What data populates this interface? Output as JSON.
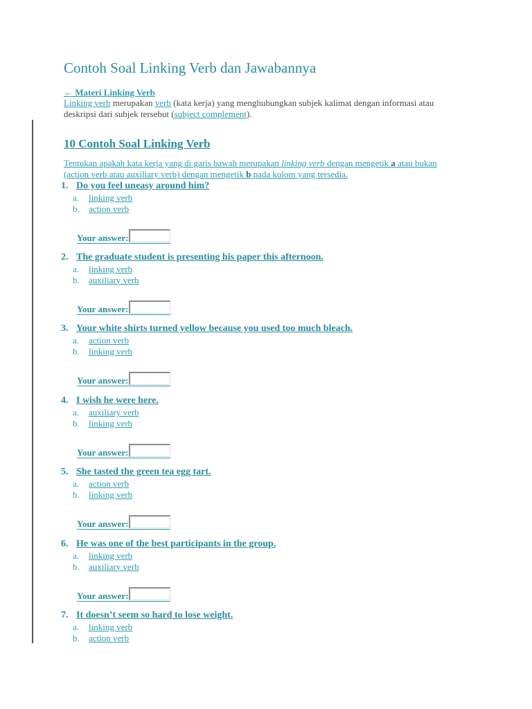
{
  "page": {
    "title": "Contoh Soal Linking Verb dan Jawabannya",
    "back_link": "← Materi Linking Verb",
    "intro": {
      "link1": "Linking verb",
      "text1": " merupakan ",
      "link2": "verb",
      "text2": " (kata kerja) yang menghubungkan subjek kalimat dengan informasi atau deskripsi dari subjek tersebut (",
      "link3": "subject complement",
      "text3": ")."
    }
  },
  "section": {
    "title": "10 Contoh Soal Linking Verb",
    "instructions": {
      "part1": "Tentukan apakah kata kerja yang di garis bawah merupakan ",
      "italic": "linking verb",
      "part2": " dengan mengetik ",
      "bold_a": "a",
      "part3": " atau bukan (action verb atau auxiliary verb) dengan mengetik ",
      "bold_b": "b",
      "part4": " pada kolom yang tersedia."
    }
  },
  "answer_label": "Your answer:",
  "questions": [
    {
      "num": "1.",
      "text": "Do you feel uneasy around him?",
      "options": [
        {
          "letter": "a.",
          "label": "linking verb"
        },
        {
          "letter": "b.",
          "label": "action verb"
        }
      ],
      "answer": ""
    },
    {
      "num": "2.",
      "text": "The graduate student is presenting his paper this afternoon.",
      "options": [
        {
          "letter": "a.",
          "label": "linking verb"
        },
        {
          "letter": "b.",
          "label": "auxiliary verb"
        }
      ],
      "answer": ""
    },
    {
      "num": "3.",
      "text": "Your white shirts turned yellow because you used too much bleach.",
      "options": [
        {
          "letter": "a.",
          "label": "action verb"
        },
        {
          "letter": "b.",
          "label": "linking verb"
        }
      ],
      "answer": ""
    },
    {
      "num": "4.",
      "text": "I wish he were here.",
      "options": [
        {
          "letter": "a.",
          "label": "auxiliary verb"
        },
        {
          "letter": "b.",
          "label": "linking verb"
        }
      ],
      "answer": ""
    },
    {
      "num": "5.",
      "text": "She tasted the green tea egg tart.",
      "options": [
        {
          "letter": "a.",
          "label": "action verb"
        },
        {
          "letter": "b.",
          "label": "linking verb"
        }
      ],
      "answer": ""
    },
    {
      "num": "6.",
      "text": "He was one of the best participants in the group.",
      "options": [
        {
          "letter": "a.",
          "label": "linking verb"
        },
        {
          "letter": "b.",
          "label": "auxiliary verb"
        }
      ],
      "answer": ""
    },
    {
      "num": "7.",
      "text": "It doesn’t seem so hard to lose weight.",
      "options": [
        {
          "letter": "a.",
          "label": "linking verb"
        },
        {
          "letter": "b.",
          "label": "action verb"
        }
      ]
    }
  ],
  "colors": {
    "heading": "#2a8ca0",
    "link": "#2a9bb0",
    "body_text": "#4a4a4a"
  }
}
